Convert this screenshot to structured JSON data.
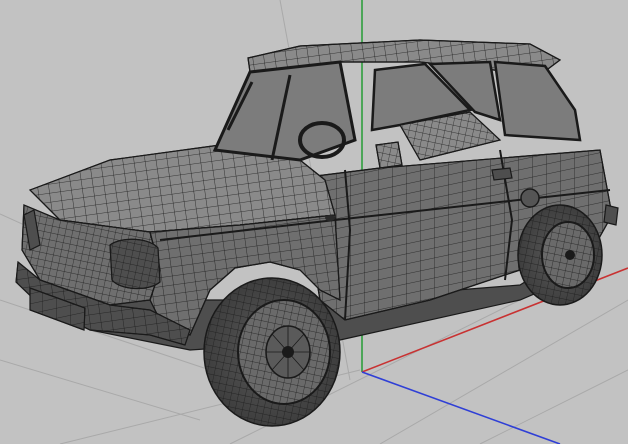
{
  "viewport": {
    "background": "#c2c2c2",
    "grid_color": "#a9a9a9",
    "axis_colors": {
      "x": "#c83232",
      "y": "#2f9e3e",
      "z": "#2f3fd6"
    },
    "model": {
      "icon": "car-wireframe-icon",
      "body_color": "#6f6f6f",
      "shade_light": "#8a8a8a",
      "shade_dark": "#4e4e4e",
      "wire_color": "#1a1a1a",
      "glass_color": "#7c7c7c"
    }
  }
}
